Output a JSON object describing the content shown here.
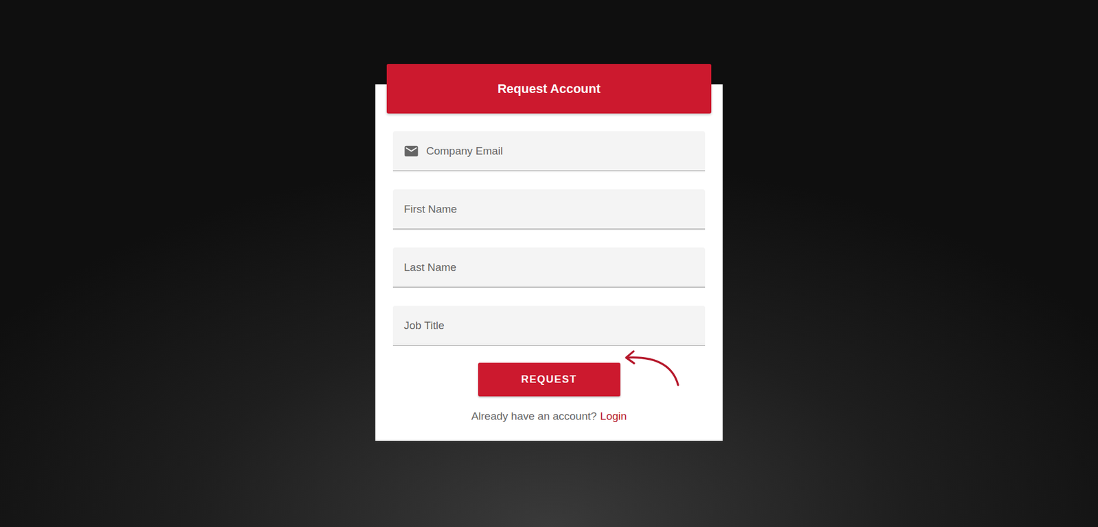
{
  "header": {
    "title": "Request Account"
  },
  "fields": [
    {
      "placeholder": "Company Email",
      "kind": "email"
    },
    {
      "placeholder": "First Name",
      "kind": "text"
    },
    {
      "placeholder": "Last Name",
      "kind": "text"
    },
    {
      "placeholder": "Job Title",
      "kind": "text"
    }
  ],
  "button": {
    "label": "REQUEST"
  },
  "footer": {
    "text": "Already have an account?",
    "link": "Login"
  }
}
